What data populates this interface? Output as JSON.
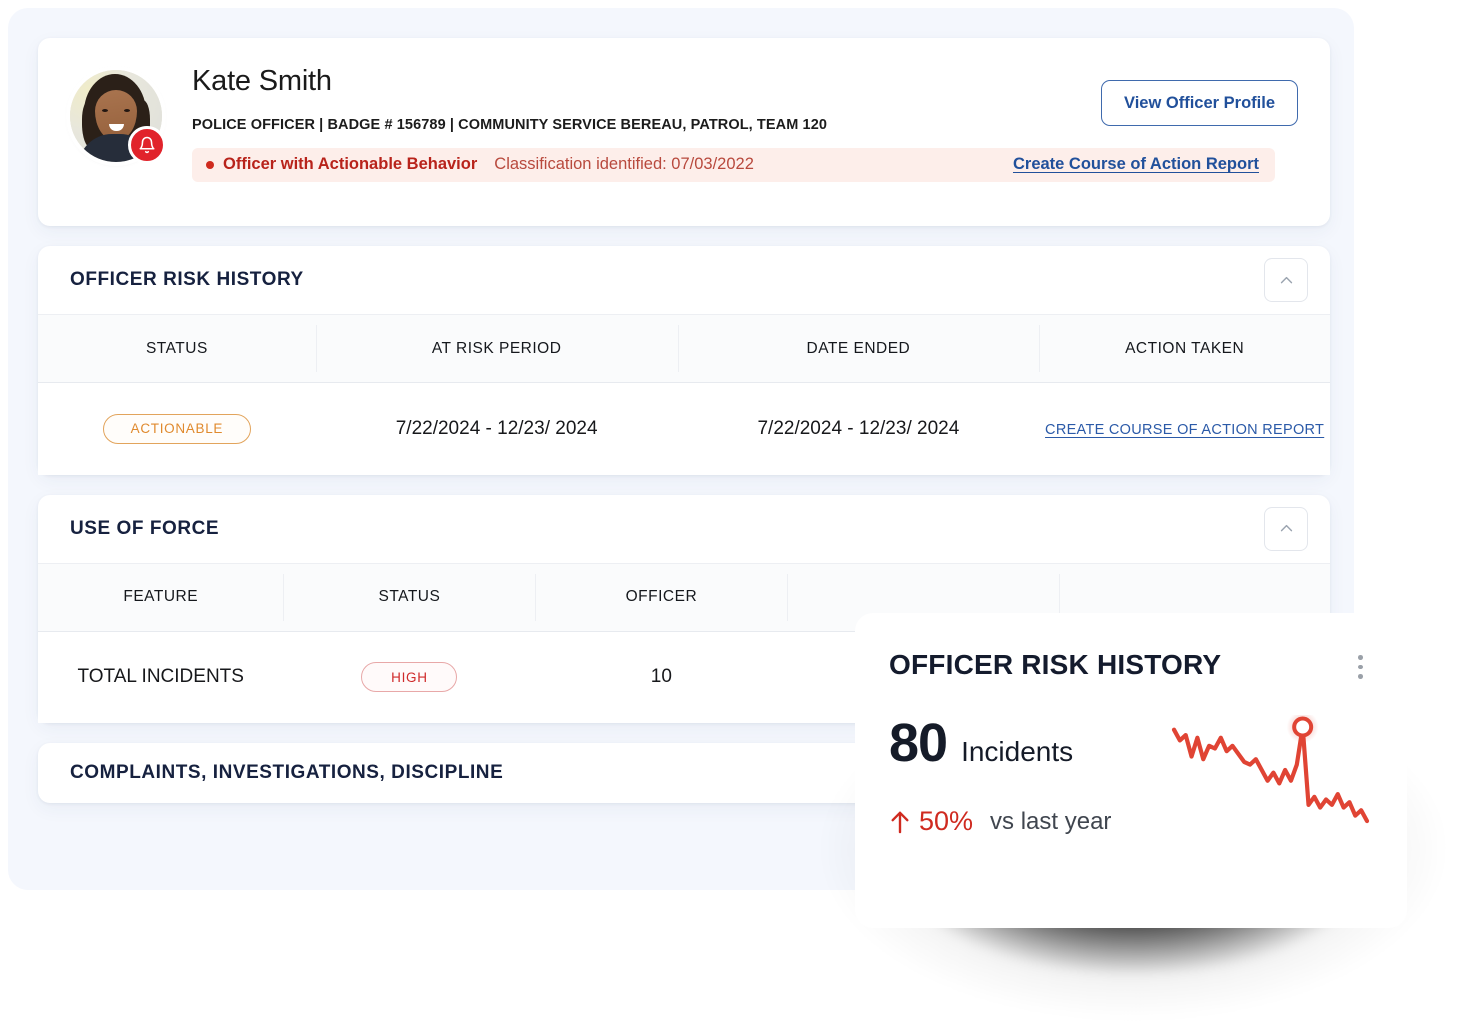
{
  "officer": {
    "name": "Kate Smith",
    "meta": "POLICE OFFICER | BADGE # 156789 | COMMUNITY SERVICE BEREAU, PATROL, TEAM 120",
    "view_profile_label": "View Officer Profile",
    "avatar_icon": "officer-photo",
    "alert_icon": "bell-icon",
    "alert": {
      "title": "Officer with Actionable Behavior",
      "subtitle": "Classification identified: 07/03/2022",
      "link_label": "Create Course of Action Report",
      "dot_icon": "status-dot-icon"
    }
  },
  "risk_history": {
    "title": "OFFICER RISK HISTORY",
    "collapse_icon": "chevron-up-icon",
    "columns": [
      "STATUS",
      "AT RISK PERIOD",
      "DATE ENDED",
      "ACTION TAKEN"
    ],
    "rows": [
      {
        "status": "ACTIONABLE",
        "at_risk_period": "7/22/2024 - 12/23/ 2024",
        "date_ended": "7/22/2024 - 12/23/ 2024",
        "action_taken": "CREATE COURSE OF ACTION REPORT"
      }
    ]
  },
  "use_of_force": {
    "title": "USE OF FORCE",
    "collapse_icon": "chevron-up-icon",
    "columns": [
      "FEATURE",
      "STATUS",
      "OFFICER"
    ],
    "rows": [
      {
        "feature": "TOTAL INCIDENTS",
        "status": "HIGH",
        "officer": "10"
      }
    ]
  },
  "complaints_section": {
    "title": "COMPLAINTS, INVESTIGATIONS, DISCIPLINE"
  },
  "widget": {
    "title": "OFFICER RISK HISTORY",
    "menu_icon": "kebab-menu-icon",
    "stat_value": "80",
    "stat_unit": "Incidents",
    "delta_icon": "arrow-up-icon",
    "delta_pct": "50%",
    "delta_label": "vs last year"
  },
  "colors": {
    "brand_blue": "#21509b",
    "alert_red": "#b8231b",
    "alert_bg": "#fdeeea",
    "accent_orange": "#e08a2e",
    "danger_red": "#cf2a20",
    "page_bg": "#f4f7fd"
  },
  "chart_data": {
    "type": "line",
    "title": "OFFICER RISK HISTORY",
    "series": [
      {
        "name": "Incidents",
        "values": [
          78,
          70,
          74,
          58,
          72,
          56,
          66,
          64,
          72,
          62,
          66,
          60,
          54,
          52,
          56,
          48,
          40,
          46,
          38,
          48,
          40,
          52,
          80,
          22,
          28,
          20,
          26,
          22,
          30,
          20,
          24,
          14,
          18,
          10
        ]
      }
    ],
    "highlight_index": 22,
    "highlight_value": 80,
    "xlabel": "",
    "ylabel": "",
    "grid": false,
    "legend": "none",
    "line_color": "#e04434",
    "summary_value": 80,
    "summary_unit": "Incidents",
    "change_pct": 50,
    "change_direction": "up",
    "change_label": "vs last year"
  }
}
